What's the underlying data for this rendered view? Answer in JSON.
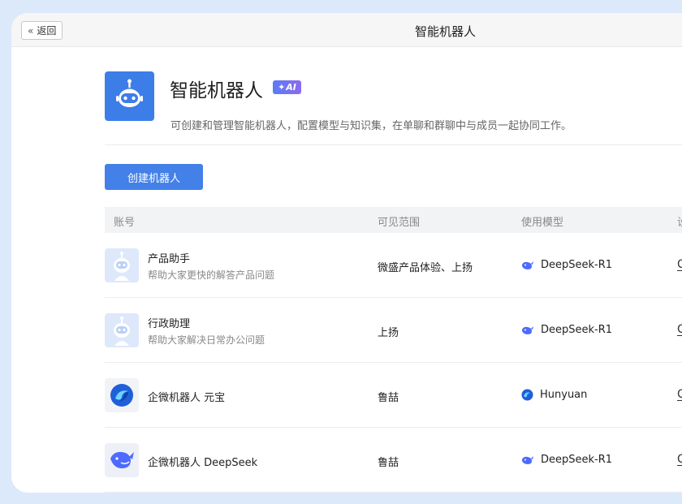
{
  "titlebar": {
    "back_label": "返回",
    "title": "智能机器人"
  },
  "header": {
    "title": "智能机器人",
    "badge": "AI",
    "description": "可创建和管理智能机器人，配置模型与知识集，在单聊和群聊中与成员一起协同工作。"
  },
  "actions": {
    "create_label": "创建机器人"
  },
  "table": {
    "columns": [
      "账号",
      "可见范围",
      "使用模型",
      "设"
    ],
    "rows": [
      {
        "name": "产品助手",
        "desc": "帮助大家更快的解答产品问题",
        "scope": "微盛产品体验、上扬",
        "model": "DeepSeek-R1",
        "model_icon": "deepseek-whale-icon",
        "avatar": "robot-avatar",
        "edge": "C"
      },
      {
        "name": "行政助理",
        "desc": "帮助大家解决日常办公问题",
        "scope": "上扬",
        "model": "DeepSeek-R1",
        "model_icon": "deepseek-whale-icon",
        "avatar": "robot-avatar",
        "edge": "C"
      },
      {
        "name": "企微机器人 元宝",
        "desc": "",
        "scope": "鲁喆",
        "model": "Hunyuan",
        "model_icon": "hunyuan-icon",
        "avatar": "yuanbao-avatar",
        "edge": "C"
      },
      {
        "name": "企微机器人 DeepSeek",
        "desc": "",
        "scope": "鲁喆",
        "model": "DeepSeek-R1",
        "model_icon": "deepseek-whale-icon",
        "avatar": "deepseek-avatar",
        "edge": "C"
      }
    ]
  },
  "colors": {
    "accent": "#4380e8",
    "app_icon_bg": "#3d7de8",
    "badge_start": "#5b7cf4",
    "badge_end": "#8d6af0"
  }
}
